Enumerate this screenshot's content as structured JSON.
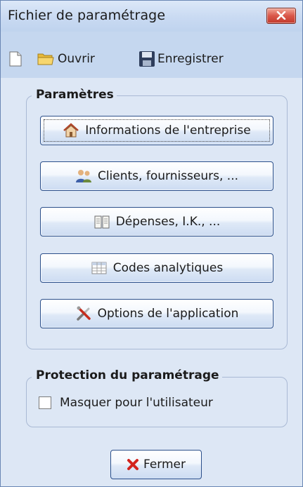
{
  "window": {
    "title": "Fichier de paramétrage"
  },
  "toolbar": {
    "new_icon": "new-document-icon",
    "open_label": "Ouvrir",
    "save_label": "Enregistrer"
  },
  "parametres": {
    "title": "Paramètres",
    "buttons": [
      {
        "label": "Informations de l'entreprise",
        "icon": "house-icon"
      },
      {
        "label": "Clients, fournisseurs, ...",
        "icon": "people-icon"
      },
      {
        "label": "Dépenses, I.K., ...",
        "icon": "book-icon"
      },
      {
        "label": "Codes analytiques",
        "icon": "table-icon"
      },
      {
        "label": "Options de l'application",
        "icon": "tools-icon"
      }
    ]
  },
  "protection": {
    "title": "Protection du paramétrage",
    "checkbox_label": "Masquer pour l'utilisateur",
    "checked": false
  },
  "footer": {
    "close_label": "Fermer"
  },
  "colors": {
    "accent": "#2b4f8a",
    "close_red": "#d9574a"
  }
}
